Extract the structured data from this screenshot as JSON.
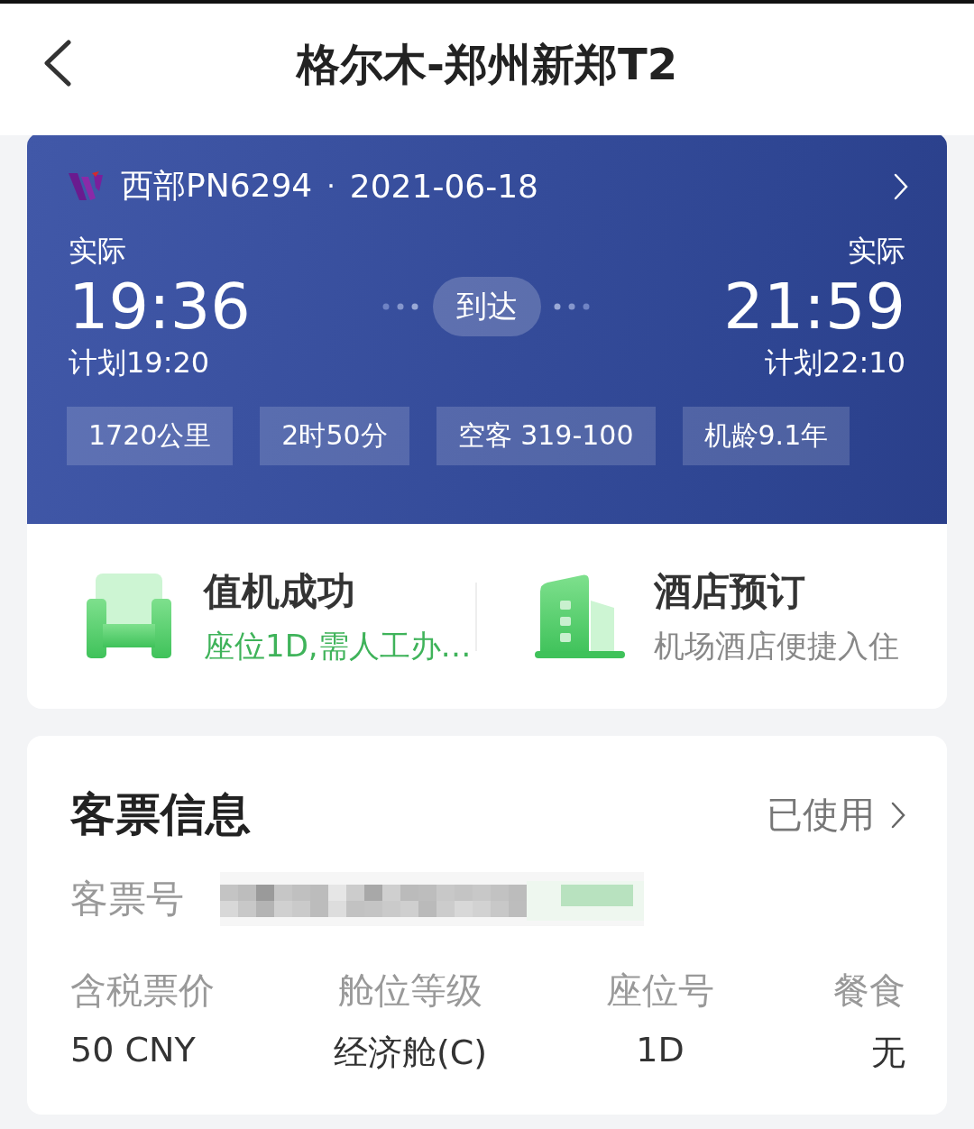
{
  "header": {
    "title": "格尔木-郑州新郑T2"
  },
  "flight": {
    "airline": "西部PN6294",
    "separator": "·",
    "date": "2021-06-18",
    "status": "到达",
    "departure": {
      "label": "实际",
      "time": "19:36",
      "planned": "计划19:20"
    },
    "arrival": {
      "label": "实际",
      "time": "21:59",
      "planned": "计划22:10"
    },
    "tags": [
      "1720公里",
      "2时50分",
      "空客 319-100",
      "机龄9.1年"
    ]
  },
  "services": [
    {
      "kind": "seat",
      "title": "值机成功",
      "subtitle": "座位1D,需人工办…",
      "highlight": true
    },
    {
      "kind": "hotel",
      "title": "酒店预订",
      "subtitle": "机场酒店便捷入住",
      "highlight": false
    }
  ],
  "ticket": {
    "title": "客票信息",
    "status": "已使用",
    "number_label": "客票号",
    "fields": [
      {
        "label": "含税票价",
        "value": "50 CNY"
      },
      {
        "label": "舱位等级",
        "value": "经济舱(C)"
      },
      {
        "label": "座位号",
        "value": "1D"
      },
      {
        "label": "餐食",
        "value": "无"
      }
    ]
  }
}
